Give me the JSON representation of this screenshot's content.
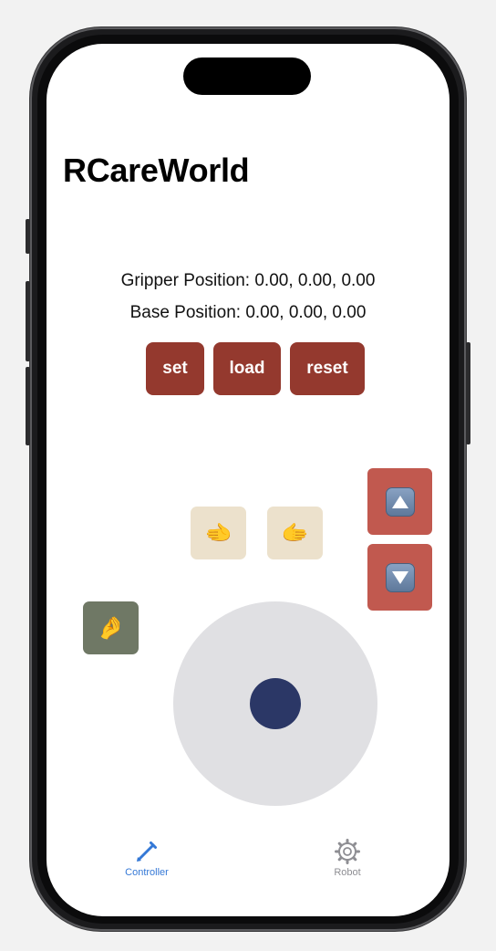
{
  "app": {
    "title": "RCareWorld"
  },
  "status": {
    "gripper_position": "Gripper Position: 0.00, 0.00, 0.00",
    "base_position": "Base Position: 0.00, 0.00, 0.00"
  },
  "actions": {
    "set_label": "set",
    "load_label": "load",
    "reset_label": "reset",
    "color": "#94392e"
  },
  "hand_controls": {
    "left_icon": "backhand-index-pointing-left-emoji",
    "left_glyph": "🫲",
    "right_icon": "backhand-index-pointing-right-emoji",
    "right_glyph": "🫱",
    "pinch_icon": "pinching-hand-emoji",
    "pinch_glyph": "🤌"
  },
  "vertical_controls": {
    "up_icon": "up-arrow-key-icon",
    "down_icon": "down-arrow-key-icon",
    "color": "#c1594f"
  },
  "joystick": {
    "base_color": "#e0e0e3",
    "knob_color": "#2b3766"
  },
  "tab_bar": {
    "tabs": [
      {
        "label": "Controller",
        "icon": "pencil-icon",
        "selected": true
      },
      {
        "label": "Robot",
        "icon": "gear-icon",
        "selected": false
      }
    ],
    "active_color": "#3478d6",
    "inactive_color": "#8e8e93"
  }
}
